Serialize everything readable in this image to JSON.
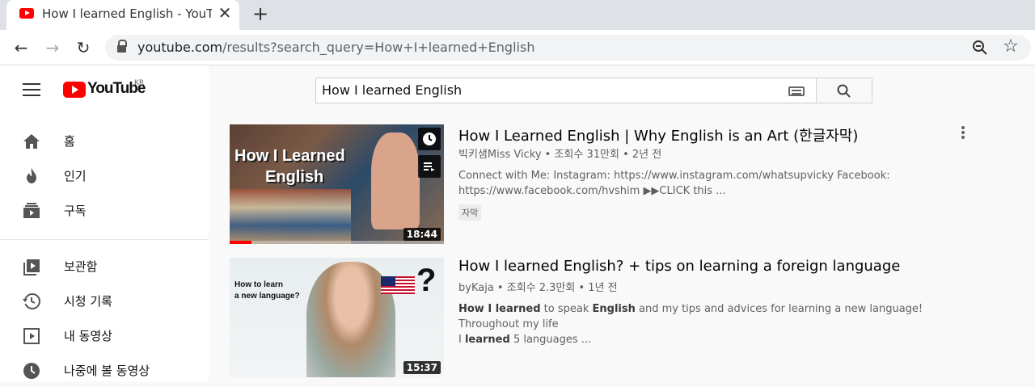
{
  "browser": {
    "tab_title": "How I learned English - YouTube",
    "url_host": "youtube.com",
    "url_path": "/results?search_query=How+I+learned+English"
  },
  "youtube": {
    "logo_text": "YouTube",
    "logo_region": "KR",
    "search_query": "How I learned English",
    "sidebar": {
      "items": [
        {
          "label": "홈",
          "icon": "home-icon"
        },
        {
          "label": "인기",
          "icon": "trending-icon"
        },
        {
          "label": "구독",
          "icon": "subscriptions-icon"
        },
        {
          "label": "보관함",
          "icon": "library-icon"
        },
        {
          "label": "시청 기록",
          "icon": "history-icon"
        },
        {
          "label": "내 동영상",
          "icon": "your-videos-icon"
        },
        {
          "label": "나중에 볼 동영상",
          "icon": "watch-later-icon"
        }
      ]
    },
    "results": [
      {
        "title": "How I Learned English | Why English is an Art (한글자막)",
        "channel": "빅키샘Miss Vicky",
        "views": "조회수 31만회",
        "age": "2년 전",
        "desc_line1": "Connect with Me: Instagram: https://www.instagram.com/whatsupvicky Facebook:",
        "desc_line2": "https://www.facebook.com/hvshim ▶▶CLICK this ...",
        "badge": "자막",
        "duration": "18:44",
        "thumb_text_1": "How I Learned",
        "thumb_text_2": "English",
        "watch_progress": 0.1
      },
      {
        "title": "How I learned English? + tips on learning a foreign language",
        "channel": "byKaja",
        "views": "조회수 2.3만회",
        "age": "1년 전",
        "desc_b1": "How I learned",
        "desc_t1": " to speak ",
        "desc_b2": "English",
        "desc_t2": " and my tips and advices for learning a new language! Throughout my life",
        "desc_t3": "I ",
        "desc_b3": "learned",
        "desc_t4": " 5 languages ...",
        "duration": "15:37",
        "thumb_text_1": "How to learn",
        "thumb_text_2": "a new language?",
        "thumb_mark": "?"
      }
    ],
    "meta_separator": " • "
  }
}
